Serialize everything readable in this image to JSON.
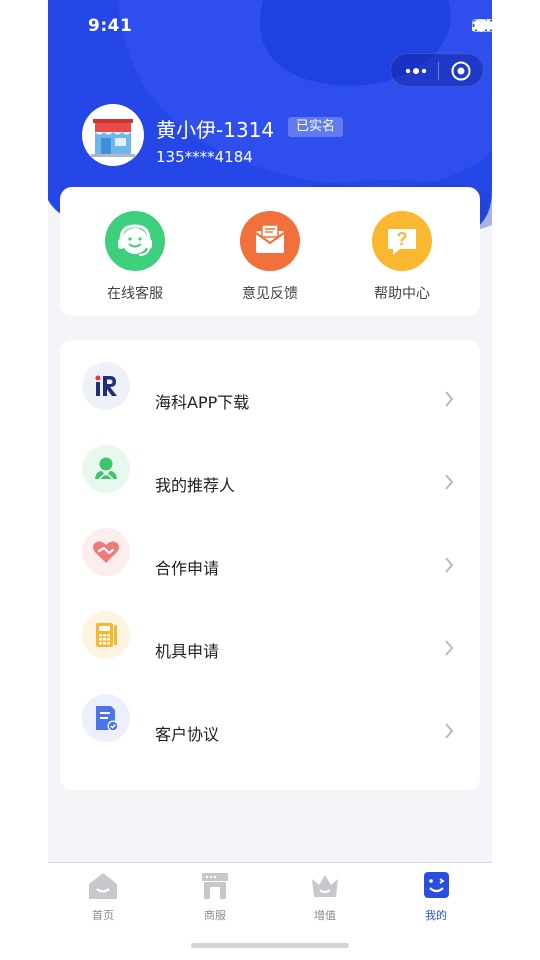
{
  "status_bar": {
    "time": "9:41"
  },
  "colors": {
    "primary": "#2a4fe0",
    "bg": "#f4f5f9",
    "text": "#222222",
    "muted": "#8a8a8f"
  },
  "profile": {
    "name": "黄小伊-1314",
    "badge": "已实名",
    "phone": "135****4184",
    "avatar_icon": "store-avatar-icon"
  },
  "quick_actions": [
    {
      "label": "在线客服",
      "icon": "headset-icon",
      "color": "#3ecf7c"
    },
    {
      "label": "意见反馈",
      "icon": "envelope-icon",
      "color": "#f2703a"
    },
    {
      "label": "帮助中心",
      "icon": "question-bubble-icon",
      "color": "#f9b830"
    }
  ],
  "menu": [
    {
      "label": "海科APP下载",
      "icon": "ir-logo-icon"
    },
    {
      "label": "我的推荐人",
      "icon": "people-icon"
    },
    {
      "label": "合作申请",
      "icon": "handshake-heart-icon"
    },
    {
      "label": "机具申请",
      "icon": "pos-machine-icon"
    },
    {
      "label": "客户协议",
      "icon": "agreement-doc-icon"
    }
  ],
  "tabbar": [
    {
      "label": "首页",
      "icon": "home-icon",
      "active": false
    },
    {
      "label": "商服",
      "icon": "shop-icon",
      "active": false
    },
    {
      "label": "增值",
      "icon": "crown-icon",
      "active": false
    },
    {
      "label": "我的",
      "icon": "smile-face-icon",
      "active": true
    }
  ]
}
